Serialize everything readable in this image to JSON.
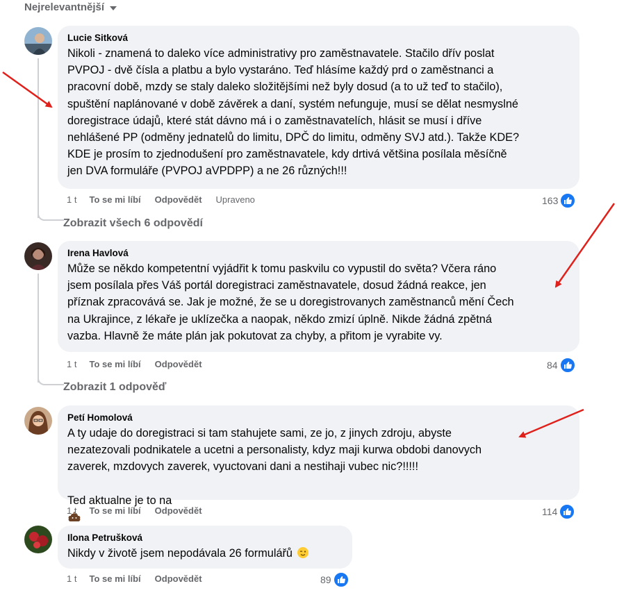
{
  "sort": {
    "label": "Nejrelevantnější"
  },
  "comments": [
    {
      "author": "Lucie Sitková",
      "text": "Nikoli - znamená to daleko více administrativy pro zaměstnavatele. Stačilo dřív poslat\nPVPOJ - dvě čísla a platbu a bylo vystaráno. Teď hlásíme každý prd o zaměstnanci a\npracovní době, mzdy se staly daleko složitějšími než byly dosud (a to už teď to stačilo),\nspuštění naplánované v době závěrek a daní, systém nefunguje, musí se dělat nesmyslné\ndoregistrace údajů, které stát dávno má i o zaměstnavatelích, hlásit se musí i dříve\nnehlášené PP (odměny jednatelů do limitu, DPČ do limitu, odměny SVJ atd.). Takže KDE?\nKDE je prosím to zjednodušení pro zaměstnavatele, kdy drtivá většina posílala měsíčně\njen DVA formuláře (PVPOJ aVPDPP) a ne 26 různých!!!",
      "time": "1 t",
      "like": "To se mi líbí",
      "reply": "Odpovědět",
      "edited": "Upraveno",
      "count": "163",
      "view_replies": "Zobrazit všech 6 odpovědí"
    },
    {
      "author": "Irena Havlová",
      "text": "Může se někdo kompetentní vyjádřit k tomu paskvilu co vypustil do světa? Včera ráno\njsem posílala přes Váš portál doregistraci zaměstnavatele, dosud žádná reakce, jen\npříznak zpracovává se. Jak je možné, že se u doregistrovanych zaměstnanců mění Čech\nna Ukrajince, z lékaře je uklízečka a naopak, někdo zmizí úplně. Nikde žádná zpětná\nvazba. Hlavně že máte plán jak pokutovat za chyby, a přitom je vyrabite vy.",
      "time": "1 t",
      "like": "To se mi líbí",
      "reply": "Odpovědět",
      "count": "84",
      "view_replies": "Zobrazit 1 odpověď"
    },
    {
      "author": "Petí Homolová",
      "text": "A ty udaje do doregistraci si tam stahujete sami, ze jo, z jinych zdroju, abyste\nnezatezovali podnikatele a ucetni a personalisty, kdyz maji kurwa obdobi danovych\nzaverek, mzdovych zaverek, vyuctovani dani a nestihaji vubec nic?!!!!!",
      "text_last": "Ted aktualne je to na",
      "time": "1 t",
      "like": "To se mi líbí",
      "reply": "Odpovědět",
      "count": "114"
    },
    {
      "author": "Ilona Petrušková",
      "text": "Nikdy v životě jsem nepodávala 26 formulářů",
      "time": "1 t",
      "like": "To se mi líbí",
      "reply": "Odpovědět",
      "count": "89"
    }
  ],
  "icons": {
    "sort": "chevron-down-icon",
    "reaction": "like-icon",
    "emoji_poop": "poop-emoji-icon",
    "emoji_sun": "sun-emoji-icon",
    "emoji_sunflower": "sunflower-emoji-icon",
    "emoji_wink": "winking-face-icon"
  },
  "colors": {
    "bubble": "#f0f2f5",
    "like": "#1877f2",
    "muted": "#65676b",
    "arrow": "#e0201b"
  }
}
